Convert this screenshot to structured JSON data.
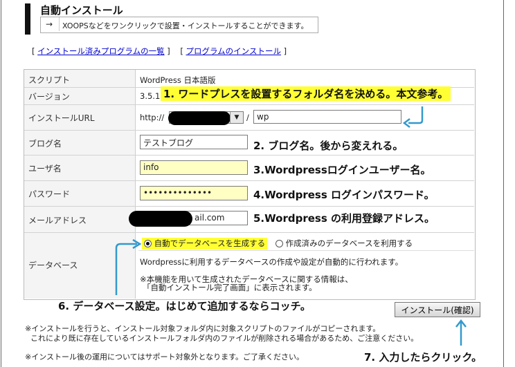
{
  "header": {
    "title": "自動インストール",
    "arrow": "→",
    "subtitle": "XOOPSなどをワンクリックで設置・インストールすることができます。"
  },
  "links": {
    "open1": "[",
    "installed": "インストール済みプログラムの一覧",
    "close1": "]",
    "open2": "[",
    "install": "プログラムのインストール",
    "close2": "]"
  },
  "form": {
    "script_label": "スクリプト",
    "script_value": "WordPress 日本語版",
    "version_label": "バージョン",
    "version_value": "3.5.1",
    "url_label": "インストールURL",
    "url_prefix": "http://",
    "url_sep": "/",
    "url_folder": "wp",
    "blog_label": "ブログ名",
    "blog_value": "テストブログ",
    "user_label": "ユーザ名",
    "user_value": "info",
    "pass_label": "パスワード",
    "pass_value": "••••••••••••••",
    "mail_label": "メールアドレス",
    "mail_value": "ail.com",
    "db_label": "データベース",
    "db_auto": "自動でデータベースを生成する",
    "db_existing": "作成済みのデータベースを利用する",
    "db_desc": "Wordpressに利用するデータベースの作成や設定が自動的に行われます。",
    "db_note1": "※本機能を用いて生成されたデータベースに関する情報は、",
    "db_note2": "「自動インストール完了画面」に表示されます。",
    "submit": "インストール(確認)"
  },
  "annotations": {
    "a1": "1. ワードプレスを設置するフォルダ名を決める。本文参考。",
    "a2": "2. ブログ名。後から変えれる。",
    "a3": "3.Wordpressログインユーザー名。",
    "a4": "4.Wordpress ログインパスワード。",
    "a5": "5.Wordpress の利用登録アドレス。",
    "a6": "6. データベース設定。はじめて追加するならコッチ。",
    "a7": "7. 入力したらクリック。"
  },
  "footer": {
    "line1": "※インストールを行うと、インストール対象フォルダ内に対象スクリプトのファイルがコピーされます。",
    "line2": "これにより既に存在しているインストールフォルダ内のファイルが削除される場合があるため、ご注意ください。",
    "line3": "※インストール後の運用についてはサポート対象外となります。ご了承ください。"
  },
  "colors": {
    "highlight": "#ffff33",
    "arrow": "#3399cc",
    "link": "#0000cc",
    "field_yellow": "#ffffc4"
  }
}
